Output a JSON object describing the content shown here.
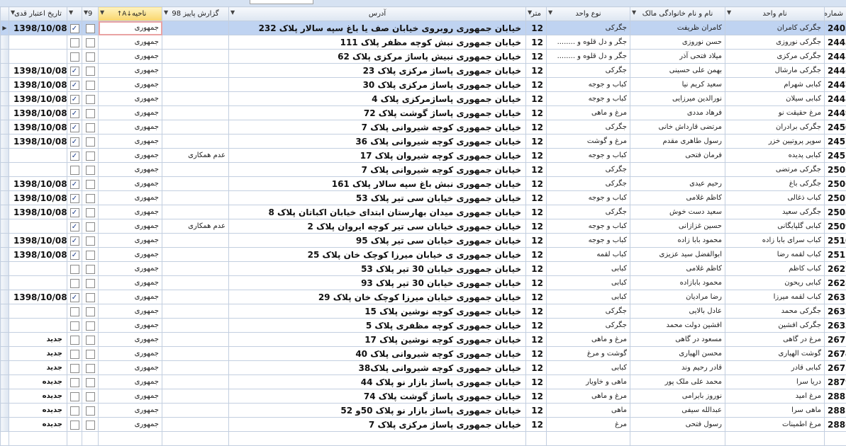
{
  "columns": [
    {
      "key": "date",
      "label": "تاریخ اعتبار قدی"
    },
    {
      "key": "c1",
      "label": ""
    },
    {
      "key": "c2",
      "label": "9"
    },
    {
      "key": "district",
      "label": "ناحیه"
    },
    {
      "key": "report",
      "label": "گزارش پاییز 98"
    },
    {
      "key": "address",
      "label": "آدرس"
    },
    {
      "key": "unit",
      "label": "متر"
    },
    {
      "key": "type",
      "label": "نوع واحد"
    },
    {
      "key": "owner",
      "label": "نام و نام خانوادگی مالک"
    },
    {
      "key": "name",
      "label": "نام واحد"
    },
    {
      "key": "num",
      "label": "شماره"
    }
  ],
  "rows": [
    {
      "date": "1398/10/08",
      "c1": true,
      "c2": false,
      "district": "جمهوری",
      "report": "",
      "address": "خیابان جمهوری روبروی خیابان صف یا باغ سپه سالار پلاک 232",
      "unit": "12",
      "type": "جگرکی",
      "owner": "کامران ظریفت",
      "name": "جگرکی کامران",
      "num": "2403"
    },
    {
      "date": "",
      "c1": false,
      "c2": false,
      "district": "جمهوری",
      "report": "",
      "address": "خیابان جمهوری نبش کوچه مظفر پلاک 111",
      "unit": "12",
      "type": "جگر و دل قلوه و ........",
      "owner": "حسن نوروزی",
      "name": "جگرکی نوروزی",
      "num": "2443"
    },
    {
      "date": "",
      "c1": false,
      "c2": false,
      "district": "جمهوری",
      "report": "",
      "address": "خیابان جمهوری نبیش پاساژ مرکزی پلاک 62",
      "unit": "12",
      "type": "جگر و دل قلوه و ........",
      "owner": "میلاد فتحی آذر",
      "name": "جگرکی مرکزی",
      "num": "2445"
    },
    {
      "date": "1398/10/08",
      "c1": true,
      "c2": false,
      "district": "جمهوری",
      "report": "",
      "address": "خیابان جمهوری پاساژ مرکزی پلاک 23",
      "unit": "12",
      "type": "جگرکی",
      "owner": "بهمن علی حسینی",
      "name": "جگرکی مارشال",
      "num": "2446"
    },
    {
      "date": "1398/10/08",
      "c1": true,
      "c2": false,
      "district": "جمهوری",
      "report": "",
      "address": "خیابان جمهوری پاساژ مرکزی پلاک 30",
      "unit": "12",
      "type": "کباب و جوجه",
      "owner": "سعید کریم نیا",
      "name": "کبابی شهرام",
      "num": "2447"
    },
    {
      "date": "1398/10/08",
      "c1": true,
      "c2": false,
      "district": "جمهوری",
      "report": "",
      "address": "خیابان جمهوری پاساژمرکزی پلاک 4",
      "unit": "12",
      "type": "کباب و جوجه",
      "owner": "نورالدین میرزایی",
      "name": "کبابی سیلان",
      "num": "2448"
    },
    {
      "date": "1398/10/08",
      "c1": true,
      "c2": false,
      "district": "جمهوری",
      "report": "",
      "address": "خیابان جمهوری پاساژ گوشت پلاک 72",
      "unit": "12",
      "type": "مرغ و ماهی",
      "owner": "فرهاد مددی",
      "name": "مرغ حقیقت نو",
      "num": "2449"
    },
    {
      "date": "1398/10/08",
      "c1": true,
      "c2": false,
      "district": "جمهوری",
      "report": "",
      "address": "خیابان جمهوری کوچه شیروانی پلاک 7",
      "unit": "12",
      "type": "جگرکی",
      "owner": "مرتضی قارداش خانی",
      "name": "جگرکی برادران",
      "num": "2450"
    },
    {
      "date": "1398/10/08",
      "c1": true,
      "c2": false,
      "district": "جمهوری",
      "report": "",
      "address": "خیابان جمهوری کوچه شیروانی پلاک 36",
      "unit": "12",
      "type": "مرغ و گوشت",
      "owner": "رسول طاهری مقدم",
      "name": "سوپر پروتیین خزر",
      "num": "2451"
    },
    {
      "date": "",
      "c1": true,
      "c2": false,
      "district": "جمهوری",
      "report": "عدم همکاری",
      "address": "خیابان جمهوری کوچه شیروان پلاک 17",
      "unit": "12",
      "type": "کباب و جوجه",
      "owner": "فرمان فتحی",
      "name": "کبابی پدیده",
      "num": "2452"
    },
    {
      "date": "",
      "c1": false,
      "c2": false,
      "district": "جمهوری",
      "report": "",
      "address": "خیابان جمهوری کوچه شیروانی پلاک 7",
      "unit": "12",
      "type": "جگرکی",
      "owner": "",
      "name": "جگرکی مرتضی",
      "num": "2505"
    },
    {
      "date": "1398/10/08",
      "c1": true,
      "c2": false,
      "district": "جمهوری",
      "report": "",
      "address": "خیابان جمهوری نبش باغ سپه سالار پلاک 161",
      "unit": "12",
      "type": "جگرکی",
      "owner": "رحیم عیدی",
      "name": "جگرکی باغ",
      "num": "2506"
    },
    {
      "date": "1398/10/08",
      "c1": true,
      "c2": false,
      "district": "جمهوری",
      "report": "",
      "address": "خیابان جمهوری خیابان سی تیر پلاک 53",
      "unit": "12",
      "type": "کباب و جوجه",
      "owner": "کاظم غلامی",
      "name": "کباب ذغالی",
      "num": "2507"
    },
    {
      "date": "1398/10/08",
      "c1": true,
      "c2": false,
      "district": "جمهوری",
      "report": "",
      "address": "خیابان جمهوری میدان بهارستان ابتدای خیابان اکباتان پلاک 8",
      "unit": "12",
      "type": "جگرکی",
      "owner": "سعید دست خوش",
      "name": "جگرکی سعید",
      "num": "2508"
    },
    {
      "date": "",
      "c1": true,
      "c2": false,
      "district": "جمهوری",
      "report": "عدم همکاری",
      "address": "خیابان جمهوری خیابان سی تیر کوچه ایروان پلاک 2",
      "unit": "12",
      "type": "کباب و جوجه",
      "owner": "حسین غزازانی",
      "name": "کبابی گلپایگانی",
      "num": "2509"
    },
    {
      "date": "1398/10/08",
      "c1": true,
      "c2": false,
      "district": "جمهوری",
      "report": "",
      "address": "خیابان جمهوری خیابان سی تیر پلاک 95",
      "unit": "12",
      "type": "کباب و جوجه",
      "owner": "محمود بابا زاده",
      "name": "کباب سرای بابا زاده",
      "num": "2510"
    },
    {
      "date": "1398/10/08",
      "c1": true,
      "c2": false,
      "district": "جمهوری",
      "report": "",
      "address": "خیابان جمهوری ی خیابان میرزا کوچک خان پلاک 25",
      "unit": "12",
      "type": "کباب لقمه",
      "owner": "ابوالفضل سید عزیزی",
      "name": "کباب لقمه رضا",
      "num": "2511"
    },
    {
      "date": "",
      "c1": false,
      "c2": false,
      "district": "جمهوری",
      "report": "",
      "address": "خیابان جمهوری خیابان 30 تیر پلاک 53",
      "unit": "12",
      "type": "کبابی",
      "owner": "کاظم غلامی",
      "name": "کباب کاظم",
      "num": "2627"
    },
    {
      "date": "",
      "c1": false,
      "c2": false,
      "district": "جمهوری",
      "report": "",
      "address": "خیابان جمهوری خیابان 30 تیر پلاک 93",
      "unit": "12",
      "type": "کبابی",
      "owner": "محمود بابازاده",
      "name": "کبابی ریحون",
      "num": "2628"
    },
    {
      "date": "1398/10/08",
      "c1": true,
      "c2": false,
      "district": "جمهوری",
      "report": "",
      "address": "خیابان جمهوری خیابان میرزا کوچک خان پلاک 29",
      "unit": "12",
      "type": "کبابی",
      "owner": "رضا مرادیان",
      "name": "کباب لقمه میرزا",
      "num": "2631"
    },
    {
      "date": "",
      "c1": false,
      "c2": false,
      "district": "جمهوری",
      "report": "",
      "address": "خیابان جمهوری کوچه نوشین پلاک 15",
      "unit": "12",
      "type": "جگرکی",
      "owner": "عادل بالایی",
      "name": "جگرکی محمد",
      "num": "2632"
    },
    {
      "date": "",
      "c1": false,
      "c2": false,
      "district": "جمهوری",
      "report": "",
      "address": "خیابان جمهوری کوچه مظفری پلاک 5",
      "unit": "12",
      "type": "جگرکی",
      "owner": "افشین دولت محمد",
      "name": "جگرکی افشین",
      "num": "2633"
    },
    {
      "date": "جدید",
      "c1": false,
      "c2": false,
      "district": "جمهوری",
      "report": "",
      "address": "خیابان جمهوری کوچه نوشین پلاک 17",
      "unit": "12",
      "type": "مرغ و ماهی",
      "owner": "مسعود در گاهی",
      "name": "مرغ در گاهی",
      "num": "2671"
    },
    {
      "date": "جدید",
      "c1": false,
      "c2": false,
      "district": "جمهوری",
      "report": "",
      "address": "خیابان جمهوری کوچه شیروانی پلاک 40",
      "unit": "12",
      "type": "گوشت و مرغ",
      "owner": "محسن الهیاری",
      "name": "گوشت الهیاری",
      "num": "2674"
    },
    {
      "date": "جدید",
      "c1": false,
      "c2": false,
      "district": "جمهوری",
      "report": "",
      "address": "خیابان جمهوری کوچه شیروانی پلاک38",
      "unit": "12",
      "type": "کبابی",
      "owner": "قادر رحیم وند",
      "name": "کبابی قادر",
      "num": "2675"
    },
    {
      "date": "جدیده",
      "c1": false,
      "c2": false,
      "district": "جمهوری",
      "report": "",
      "address": "خیابان جمهوری پاساژ بازار نو پلاک 44",
      "unit": "12",
      "type": "ماهی و خاویار",
      "owner": "محمد علی ملک پور",
      "name": "دریا سرا",
      "num": "2879"
    },
    {
      "date": "جدیده",
      "c1": false,
      "c2": false,
      "district": "جمهوری",
      "report": "",
      "address": "خیابان جمهوری پاساژ گوشت پلاک 74",
      "unit": "12",
      "type": "مرغ و ماهی",
      "owner": "نوروز بایرامی",
      "name": "مرغ امید",
      "num": "2881"
    },
    {
      "date": "جدیده",
      "c1": false,
      "c2": false,
      "district": "جمهوری",
      "report": "",
      "address": "خیابان جمهوری پاساژ بازار نو پلاک 50و 52",
      "unit": "12",
      "type": "ماهی",
      "owner": "عبدالله سیفی",
      "name": "ماهی سرا",
      "num": "2885"
    },
    {
      "date": "جدیده",
      "c1": false,
      "c2": false,
      "district": "جمهوری",
      "report": "",
      "address": "خیابان جمهوری پاساژ مرکزی پلاک 7",
      "unit": "12",
      "type": "مرغ",
      "owner": "رسول فتحی",
      "name": "مرغ اطمینات",
      "num": "2886"
    }
  ]
}
